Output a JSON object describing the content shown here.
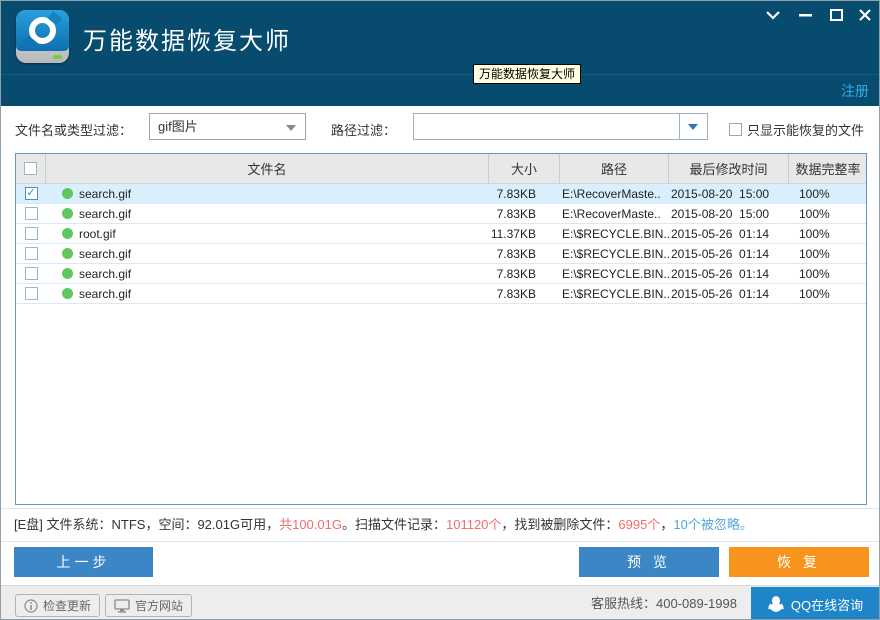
{
  "window": {
    "title": "万能数据恢复大师",
    "register_label": "注册",
    "tooltip_text": "万能数据恢复大师"
  },
  "filters": {
    "name_filter_label": "文件名或类型过滤：",
    "name_filter_value": "gif图片",
    "path_filter_label": "路径过滤：",
    "path_filter_value": "",
    "only_recoverable_label": "只显示能恢复的文件",
    "only_recoverable_checked": false
  },
  "table": {
    "columns": [
      "文件名",
      "大小",
      "路径",
      "最后修改时间",
      "数据完整率"
    ],
    "rows": [
      {
        "checked": true,
        "selected": true,
        "name": "search.gif",
        "size": "7.83KB",
        "path": "E:\\RecoverMaste..",
        "modified": "2015-08-20  15:00",
        "integrity": "100%"
      },
      {
        "checked": false,
        "selected": false,
        "name": "search.gif",
        "size": "7.83KB",
        "path": "E:\\RecoverMaste..",
        "modified": "2015-08-20  15:00",
        "integrity": "100%"
      },
      {
        "checked": false,
        "selected": false,
        "name": "root.gif",
        "size": "11.37KB",
        "path": "E:\\$RECYCLE.BIN..",
        "modified": "2015-05-26  01:14",
        "integrity": "100%"
      },
      {
        "checked": false,
        "selected": false,
        "name": "search.gif",
        "size": "7.83KB",
        "path": "E:\\$RECYCLE.BIN..",
        "modified": "2015-05-26  01:14",
        "integrity": "100%"
      },
      {
        "checked": false,
        "selected": false,
        "name": "search.gif",
        "size": "7.83KB",
        "path": "E:\\$RECYCLE.BIN..",
        "modified": "2015-05-26  01:14",
        "integrity": "100%"
      },
      {
        "checked": false,
        "selected": false,
        "name": "search.gif",
        "size": "7.83KB",
        "path": "E:\\$RECYCLE.BIN..",
        "modified": "2015-05-26  01:14",
        "integrity": "100%"
      }
    ]
  },
  "status": {
    "segments": [
      {
        "text": "[E盘] 文件系统：NTFS，空间：92.01G可用，",
        "color": "#333333"
      },
      {
        "text": "共100.01G",
        "color": "#f56c6c"
      },
      {
        "text": "。扫描文件记录：",
        "color": "#333333"
      },
      {
        "text": "101120个",
        "color": "#f56c6c"
      },
      {
        "text": "，找到被删除文件：",
        "color": "#333333"
      },
      {
        "text": "6995个",
        "color": "#f56c6c"
      },
      {
        "text": "，",
        "color": "#333333"
      },
      {
        "text": "10个被忽略。",
        "color": "#56a6dd"
      }
    ]
  },
  "buttons": {
    "prev_label": "上一步",
    "preview_label": "预 览",
    "recover_label": "恢 复"
  },
  "footer": {
    "check_update_label": "检查更新",
    "official_site_label": "官方网站",
    "hotline_label": "客服热线：400-089-1998",
    "qq_label": "QQ在线咨询"
  },
  "colors": {
    "header_blue": "#074b6e",
    "accent_blue": "#3b86c4",
    "accent_orange": "#f7941d",
    "qq_blue": "#1e86c8",
    "register_blue": "#35aee4",
    "selected_row": "#d9effb",
    "status_red": "#f56c6c",
    "status_blue": "#56a6dd",
    "dot_green": "#5fc75f"
  }
}
